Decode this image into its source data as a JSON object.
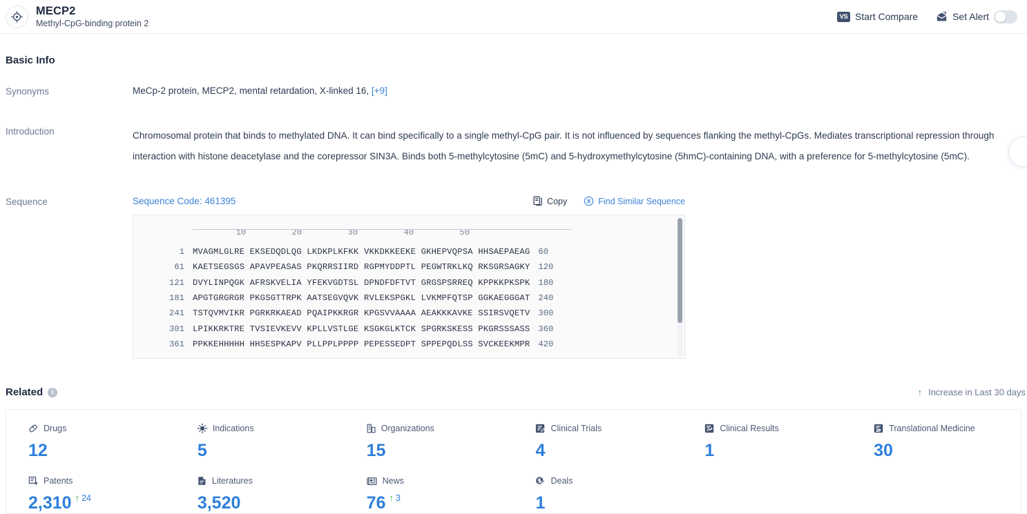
{
  "header": {
    "logo_icon": "target-crosshair-icon",
    "gene_symbol": "MECP2",
    "gene_name": "Methyl-CpG-binding protein 2",
    "start_compare_label": "Start Compare",
    "start_compare_icon": "vs-badge-icon",
    "vs_badge_text": "VS",
    "set_alert_label": "Set Alert",
    "set_alert_icon": "alert-mail-icon",
    "alert_toggle_state": "off"
  },
  "basic_info": {
    "title": "Basic Info",
    "synonyms_label": "Synonyms",
    "synonyms": [
      "MeCp-2 protein, ",
      "MECP2, ",
      "mental retardation, X-linked 16, "
    ],
    "synonyms_more": "[+9]",
    "introduction_label": "Introduction",
    "introduction": "Chromosomal protein that binds to methylated DNA. It can bind specifically to a single methyl-CpG pair. It is not influenced by sequences flanking the methyl-CpGs. Mediates transcriptional repression through interaction with histone deacetylase and the corepressor SIN3A. Binds both 5-methylcytosine (5mC) and 5-hydroxymethylcytosine (5hmC)-containing DNA, with a preference for 5-methylcytosine (5mC).",
    "sequence_label": "Sequence",
    "sequence_code": "Sequence Code: 461395",
    "copy_label": "Copy",
    "copy_icon": "copy-icon",
    "find_similar_label": "Find Similar Sequence",
    "find_similar_icon": "find-similar-sequence-icon"
  },
  "sequence_viewer": {
    "ruler_ticks": [
      "10",
      "20",
      "30",
      "40",
      "50"
    ],
    "rows": [
      {
        "start": "1",
        "blocks": "MVAGMLGLRE EKSEDQDLQG LKDKPLKFKK VKKDKKEEKE GKHEPVQPSA HHSAEPAEAG",
        "end": "60"
      },
      {
        "start": "61",
        "blocks": "KAETSEGSGS APAVPEASAS PKQRRSIIRD RGPMYDDPTL PEGWTRKLKQ RKSGRSAGKY",
        "end": "120"
      },
      {
        "start": "121",
        "blocks": "DVYLINPQGK AFRSKVELIA YFEKVGDTSL DPNDFDFTVT GRGSPSRREQ KPPKKPKSPK",
        "end": "180"
      },
      {
        "start": "181",
        "blocks": "APGTGRGRGR PKGSGTTRPK AATSEGVQVK RVLEKSPGKL LVKMPFQTSP GGKAEGGGAT",
        "end": "240"
      },
      {
        "start": "241",
        "blocks": "TSTQVMVIKR PGRKRKAEAD PQAIPKKRGR KPGSVVAAAA AEAKKKAVKE SSIRSVQETV",
        "end": "300"
      },
      {
        "start": "301",
        "blocks": "LPIKKRKTRE TVSIEVKEVV KPLLVSTLGE KSGKGLKTCK SPGRKSKESS PKGRSSSASS",
        "end": "360"
      },
      {
        "start": "361",
        "blocks": "PPKKEHHHHH HHSESPKAPV PLLPPLPPPP PEPESSEDPT SPPEPQDLSS SVCKEEKMPR",
        "end": "420"
      }
    ]
  },
  "related": {
    "title": "Related",
    "info_icon": "info-icon",
    "info_glyph": "i",
    "legend_label": "Increase in Last 30 days",
    "legend_icon": "green-up-arrow-icon",
    "arrow_glyph": "↑",
    "accent_color": "#2e7fdb",
    "increase_color": "#3fae4a",
    "cards": [
      {
        "label": "Drugs",
        "icon": "pill-icon",
        "value": "12",
        "delta": null
      },
      {
        "label": "Indications",
        "icon": "virus-icon",
        "value": "5",
        "delta": null
      },
      {
        "label": "Organizations",
        "icon": "building-icon",
        "value": "15",
        "delta": null
      },
      {
        "label": "Clinical Trials",
        "icon": "clinical-trial-icon",
        "value": "4",
        "delta": null
      },
      {
        "label": "Clinical Results",
        "icon": "clinical-result-icon",
        "value": "1",
        "delta": null
      },
      {
        "label": "Translational Medicine",
        "icon": "translational-med-icon",
        "value": "30",
        "delta": null
      },
      {
        "label": "Patents",
        "icon": "patent-icon",
        "value": "2,310",
        "delta": "24"
      },
      {
        "label": "Literatures",
        "icon": "literature-icon",
        "value": "3,520",
        "delta": null
      },
      {
        "label": "News",
        "icon": "news-icon",
        "value": "76",
        "delta": "3"
      },
      {
        "label": "Deals",
        "icon": "deal-icon",
        "value": "1",
        "delta": null
      }
    ]
  }
}
